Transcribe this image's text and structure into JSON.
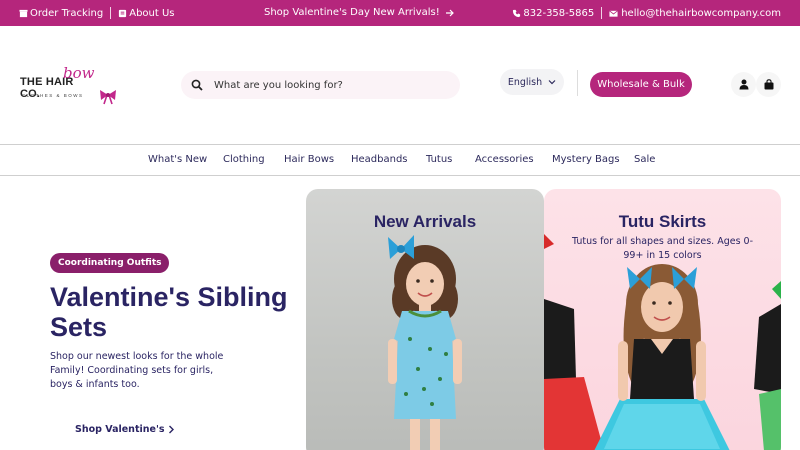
{
  "topbar": {
    "order_tracking": "Order Tracking",
    "about_us": "About Us",
    "announcement": "Shop Valentine's Day New Arrivals!",
    "phone": "832-358-5865",
    "email": "hello@thehairbowcompany.com"
  },
  "logo": {
    "word_left": "THE HAIR",
    "word_script": "bow",
    "word_right": "CO.",
    "tagline": "CLOTHES & BOWS"
  },
  "search": {
    "placeholder": "What are you looking for?"
  },
  "language": {
    "selected": "English"
  },
  "wholesale_label": "Wholesale & Bulk",
  "nav": [
    "What's New",
    "Clothing",
    "Hair Bows",
    "Headbands",
    "Tutus",
    "Accessories",
    "Mystery Bags",
    "Sale"
  ],
  "hero": {
    "badge": "Coordinating Outfits",
    "title": "Valentine's Sibling Sets",
    "description": "Shop our newest looks for the whole Family! Coordinating sets for girls, boys & infants too.",
    "cta": "Shop Valentine's"
  },
  "cards": [
    {
      "title": "New Arrivals",
      "subtitle": ""
    },
    {
      "title": "Tutu Skirts",
      "subtitle": "Tutus for all shapes and sizes. Ages 0-99+ in 15 colors"
    }
  ],
  "colors": {
    "brand": "#b5267c",
    "navy": "#2a2463",
    "badge": "#8a1f6a"
  },
  "icons": [
    "store-icon",
    "info-icon",
    "arrow-right-icon",
    "phone-icon",
    "mail-icon",
    "search-icon",
    "chevron-down-icon",
    "user-icon",
    "bag-icon"
  ]
}
